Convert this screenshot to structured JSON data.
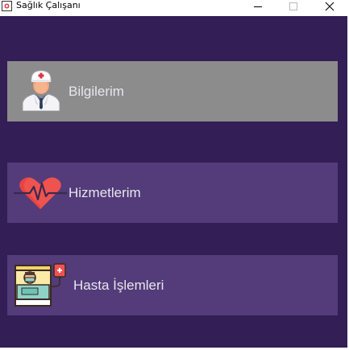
{
  "window": {
    "title": "Sağlık Çalışanı",
    "controls": {
      "minimize": "minimize-icon",
      "maximize": "maximize-icon",
      "close": "close-icon"
    }
  },
  "menu": {
    "items": [
      {
        "label": "Bilgilerim",
        "icon": "doctor-icon",
        "state": "selected"
      },
      {
        "label": "Hizmetlerim",
        "icon": "heartbeat-icon",
        "state": "normal"
      },
      {
        "label": "Hasta İşlemleri",
        "icon": "patient-bed-icon",
        "state": "normal"
      }
    ]
  },
  "colors": {
    "background": "#331e56",
    "button": "#533c79",
    "button_selected": "#8c8c8c",
    "label_text": "#e8e6ee"
  }
}
